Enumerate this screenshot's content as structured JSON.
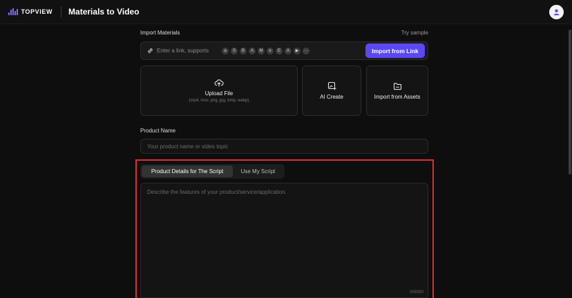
{
  "header": {
    "brand": "TOPVIEW",
    "title": "Materials to Video"
  },
  "import": {
    "label": "Import Materials",
    "try_sample": "Try sample",
    "link_placeholder": "Enter a link, supports",
    "platforms": [
      {
        "name": "amazon",
        "glyph": "a"
      },
      {
        "name": "shopify",
        "glyph": "S"
      },
      {
        "name": "shopping-bag",
        "glyph": "B"
      },
      {
        "name": "aliexpress",
        "glyph": "A"
      },
      {
        "name": "mail",
        "glyph": "M"
      },
      {
        "name": "ebay",
        "glyph": "e"
      },
      {
        "name": "etsy",
        "glyph": "E"
      },
      {
        "name": "app-store",
        "glyph": "A"
      },
      {
        "name": "google-play",
        "glyph": "▶"
      },
      {
        "name": "more",
        "glyph": "···"
      }
    ],
    "import_button": "Import from Link"
  },
  "cards": {
    "upload": {
      "title": "Upload File",
      "sub": "(mp4, mov, png, jpg, bmp, webp)"
    },
    "ai_create": {
      "title": "AI Create"
    },
    "assets": {
      "title": "Import from Assets"
    }
  },
  "product": {
    "label": "Product Name",
    "placeholder": "Your product name or video topic"
  },
  "script": {
    "tabs": [
      "Product Details for The Script",
      "Use My Script"
    ],
    "placeholder": "Describe the features of your product/service/application.",
    "counter": "0/5000"
  },
  "colors": {
    "accent": "#5b48f2",
    "highlight": "#e0302e",
    "background": "#0e0e0e"
  }
}
